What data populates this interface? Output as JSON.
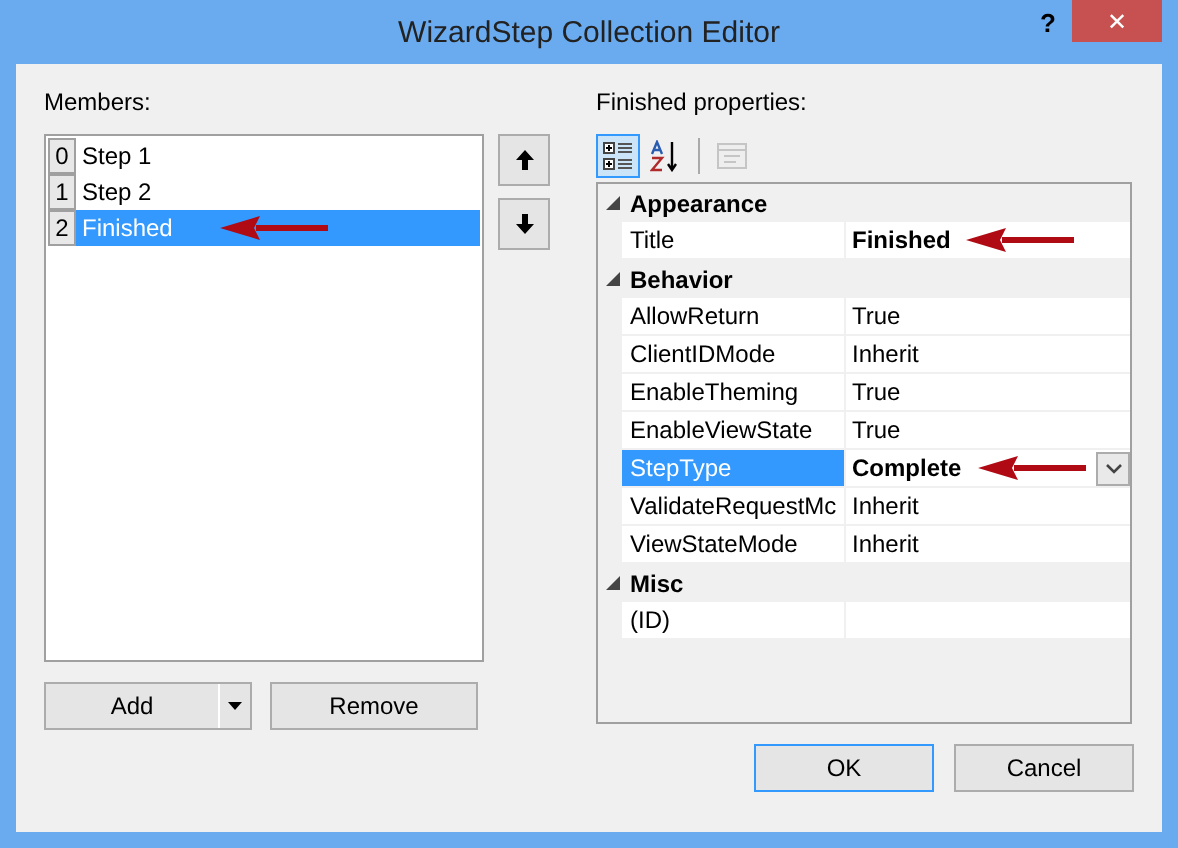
{
  "window": {
    "title": "WizardStep Collection Editor",
    "help": "?",
    "close": "✕"
  },
  "members": {
    "label": "Members:",
    "items": [
      {
        "index": "0",
        "label": "Step 1",
        "selected": false,
        "annotated": false
      },
      {
        "index": "1",
        "label": "Step 2",
        "selected": false,
        "annotated": false
      },
      {
        "index": "2",
        "label": "Finished",
        "selected": true,
        "annotated": true
      }
    ],
    "add": "Add",
    "remove": "Remove"
  },
  "properties": {
    "label": "Finished properties:",
    "toolbar": [
      {
        "kind": "categorized",
        "selected": true,
        "disabled": false
      },
      {
        "kind": "alphabetical",
        "selected": false,
        "disabled": false
      },
      {
        "kind": "pages",
        "selected": false,
        "disabled": true
      }
    ],
    "rows": [
      {
        "kind": "category",
        "name": "Appearance",
        "expanded": true
      },
      {
        "kind": "property",
        "name": "Title",
        "value": "Finished",
        "modified": true,
        "selected": false,
        "annotated": true
      },
      {
        "kind": "category",
        "name": "Behavior",
        "expanded": true
      },
      {
        "kind": "property",
        "name": "AllowReturn",
        "value": "True",
        "modified": false,
        "selected": false,
        "annotated": false
      },
      {
        "kind": "property",
        "name": "ClientIDMode",
        "value": "Inherit",
        "modified": false,
        "selected": false,
        "annotated": false
      },
      {
        "kind": "property",
        "name": "EnableTheming",
        "value": "True",
        "modified": false,
        "selected": false,
        "annotated": false
      },
      {
        "kind": "property",
        "name": "EnableViewState",
        "value": "True",
        "modified": false,
        "selected": false,
        "annotated": false
      },
      {
        "kind": "property",
        "name": "StepType",
        "value": "Complete",
        "modified": true,
        "selected": true,
        "annotated": true
      },
      {
        "kind": "property",
        "name": "ValidateRequestMc",
        "value": "Inherit",
        "modified": false,
        "selected": false,
        "annotated": false
      },
      {
        "kind": "property",
        "name": "ViewStateMode",
        "value": "Inherit",
        "modified": false,
        "selected": false,
        "annotated": false
      },
      {
        "kind": "category",
        "name": "Misc",
        "expanded": true
      },
      {
        "kind": "property",
        "name": "(ID)",
        "selected": false,
        "annotated": false
      }
    ]
  },
  "buttons": [
    {
      "label": "OK",
      "default": true
    },
    {
      "label": "Cancel",
      "default": false
    }
  ]
}
